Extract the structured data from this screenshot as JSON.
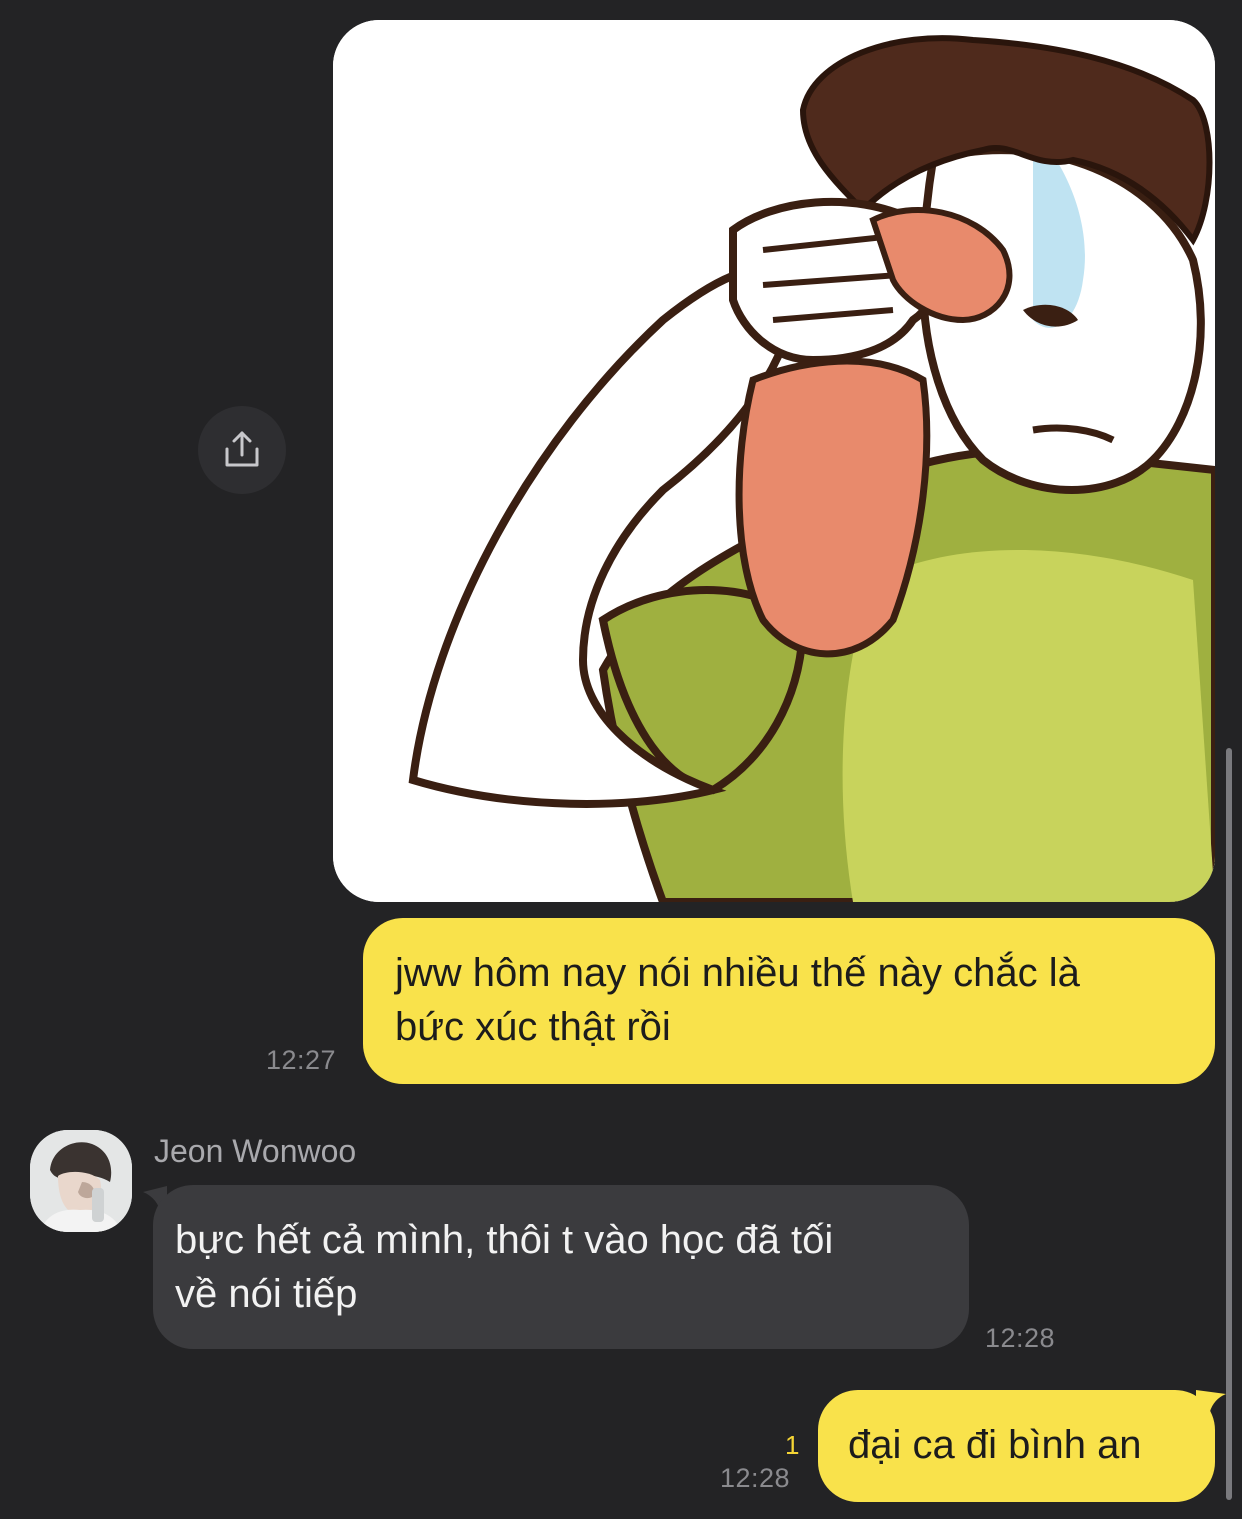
{
  "conversation": {
    "image_message": {
      "alt": "sweating man wiping forehead with towel"
    },
    "share_icon": "share-upload-icon",
    "messages": [
      {
        "direction": "outgoing",
        "text": "jww hôm nay nói nhiều thế này chắc là\nbức xúc thật rồi",
        "time": "12:27"
      },
      {
        "direction": "incoming",
        "sender": "Jeon Wonwoo",
        "text": "bực hết cả mình, thôi t vào học đã tối\nvề nói tiếp",
        "time": "12:28"
      },
      {
        "direction": "outgoing",
        "text": "đại ca đi bình an",
        "time": "12:28",
        "unread": "1"
      }
    ]
  },
  "colors": {
    "background": "#232325",
    "outgoing_bubble": "#f9e24b",
    "incoming_bubble": "#3b3b3e",
    "unread_count": "#f5d535"
  }
}
